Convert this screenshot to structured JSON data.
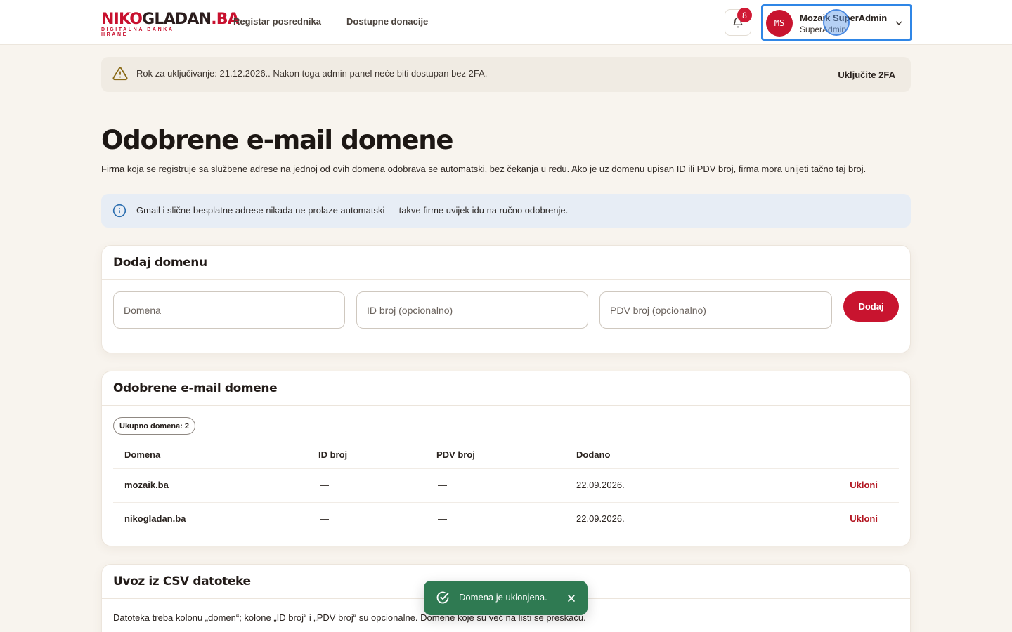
{
  "brand": {
    "name_red": "NIKO",
    "name_dark": "GLADAN",
    "name_tld": ".BA",
    "tagline": "DIGITALNA BANKA HRANE"
  },
  "nav": {
    "items": [
      {
        "label": "Registar posrednika"
      },
      {
        "label": "Dostupne donacije"
      }
    ]
  },
  "notifications": {
    "icon": "bell-icon",
    "count": "8"
  },
  "user": {
    "initials": "MS",
    "name": "Mozaik SuperAdmin",
    "role": "SuperAdmin"
  },
  "banner": {
    "text": "Rok za uključivanje: 21.12.2026.. Nakon toga admin panel neće biti dostupan bez 2FA.",
    "action": "Uključite 2FA"
  },
  "page": {
    "title": "Odobrene e-mail domene",
    "description": "Firma koja se registruje sa službene adrese na jednoj od ovih domena odobrava se automatski, bez čekanja u redu. Ako je uz domenu upisan ID ili PDV broj, firma mora unijeti tačno taj broj."
  },
  "info": {
    "text": "Gmail i slične besplatne adrese nikada ne prolaze automatski — takve firme uvijek idu na ručno odobrenje."
  },
  "add_form": {
    "title": "Dodaj domenu",
    "domain_placeholder": "Domena",
    "id_placeholder": "ID broj (opcionalno)",
    "pdv_placeholder": "PDV broj (opcionalno)",
    "submit_label": "Dodaj"
  },
  "list": {
    "title": "Odobrene e-mail domene",
    "count_label": "Ukupno domena: 2",
    "columns": {
      "domain": "Domena",
      "id": "ID broj",
      "pdv": "PDV broj",
      "added": "Dodano"
    },
    "rows": [
      {
        "domain": "mozaik.ba",
        "id": "—",
        "pdv": "—",
        "added": "22.09.2026.",
        "action": "Ukloni"
      },
      {
        "domain": "nikogladan.ba",
        "id": "—",
        "pdv": "—",
        "added": "22.09.2026.",
        "action": "Ukloni"
      }
    ]
  },
  "csv": {
    "title": "Uvoz iz CSV datoteke",
    "text": "Datoteka treba kolonu „domen“; kolone „ID broj“ i „PDV broj“ su opcionalne. Domene koje su već na listi se preskaču."
  },
  "toast": {
    "text": "Domena je uklonjena."
  }
}
